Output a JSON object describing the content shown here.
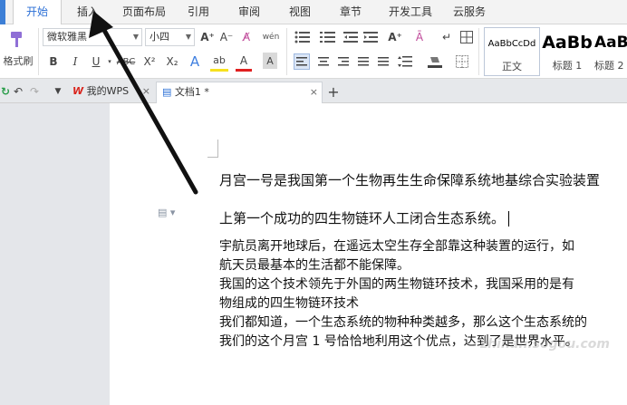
{
  "tabs": [
    {
      "label": "开始",
      "active": true
    },
    {
      "label": "插入"
    },
    {
      "label": "页面布局"
    },
    {
      "label": "引用"
    },
    {
      "label": "审阅"
    },
    {
      "label": "视图"
    },
    {
      "label": "章节"
    },
    {
      "label": "开发工具"
    },
    {
      "label": "云服务"
    }
  ],
  "toolbar": {
    "format_painter": "格式刷",
    "font_name": "微软雅黑",
    "font_size": "小四",
    "grow_font": "A⁺",
    "shrink_font": "A⁻",
    "clear_format": "A̸",
    "phonetic": "wén",
    "bold": "B",
    "italic": "I",
    "underline": "U",
    "strikethrough": "ABC",
    "superscript": "X²",
    "subscript": "X₂",
    "text_effect": "A",
    "highlight": "ab",
    "font_color": "A",
    "char_shading": "A",
    "styles": [
      {
        "sample": "AaBbCcDd",
        "label": "正文"
      },
      {
        "sample": "AaBb",
        "label": "标题 1"
      },
      {
        "sample": "AaBb",
        "label": "标题 2"
      }
    ]
  },
  "doc_tabs": [
    {
      "label": "我的WPS",
      "icon": "wps-logo-icon"
    },
    {
      "label": "文档1 *",
      "icon": "document-icon",
      "active": true
    }
  ],
  "document": {
    "lines": [
      "月宫一号是我国第一个生物再生生命保障系统地基综合实验装置",
      "上第一个成功的四生物链环人工闭合生态系统。",
      "宇航员离开地球后，在遥远太空生存全部靠这种装置的运行，如",
      "航天员最基本的生活都不能保障。",
      "我国的这个技术领先于外国的两生物链环技术，我国采用的是有",
      "物组成的四生物链环技术",
      "我们都知道，一个生态系统的物种种类越多，那么这个生态系统的",
      "我们的这个月宫 1 号恰恰地利用这个优点，达到了是世界水平。"
    ]
  },
  "watermark": "zhinan.sogou.com",
  "colors": {
    "accent": "#2b6fd6",
    "tab_strip": "#3d7fd6",
    "wps_red": "#d9241c"
  }
}
